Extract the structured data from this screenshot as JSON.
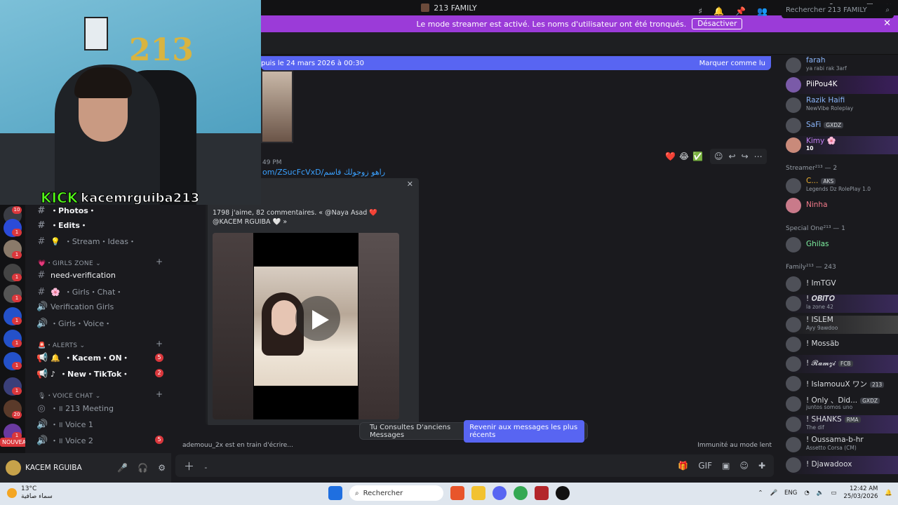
{
  "window": {
    "title": "213 FAMILY",
    "controls": [
      "—",
      "☐",
      "✕"
    ]
  },
  "streamer_banner": {
    "text": "Le mode streamer est activé. Les noms d'utilisateur ont été tronqués.",
    "button": "Désactiver"
  },
  "header": {
    "search_placeholder": "Rechercher 213 FAMILY"
  },
  "new_messages_bar": {
    "text": "puis le 24 mars 2026 à 00:30",
    "action": "Marquer comme lu"
  },
  "message": {
    "time": "49 PM",
    "link": "om/ZSucFcVxD/",
    "link_rtl": "راهو زوجولك قاسم",
    "embed_desc": "1798 j'aime, 82 commentaires. « @Naya Asad ❤️ @KACEM RGUIBA 🤍 »"
  },
  "older_bar": {
    "text": "Tu Consultes D'anciens Messages",
    "button": "Revenir aux messages les plus récents"
  },
  "typing": {
    "text": "ademouu_2x est en train d'écrire...",
    "slowmode": "Immunité au mode lent"
  },
  "composer": {
    "placeholder": "-"
  },
  "channels": {
    "photos": "・Photos・",
    "edits": "・Edits・",
    "stream_ideas": "・Stream・Ideas・",
    "cat_girls": "・GIRLS ZONE",
    "need_verification": "need-verification",
    "girls_chat": "・Girls・Chat・",
    "verification_girls": "Verification Girls",
    "girls_voice": "・Girls・Voice・",
    "cat_alerts": "・ALERTS",
    "kacem_on": "・Kacem・ON・",
    "kacem_on_badge": "5",
    "new_tiktok": "・New・TikTok・",
    "new_tiktok_badge": "2",
    "cat_voice": "・VOICE CHAT",
    "meeting": "・॥ 213 Meeting",
    "voice1": "・॥ Voice 1",
    "voice2": "・॥ Voice 2",
    "voice2_badge": "5"
  },
  "rail_badges": [
    "10",
    "1",
    "1",
    "1",
    "1",
    "1",
    "1",
    "1",
    "1",
    "20",
    "1"
  ],
  "nouveau": "NOUVEAU",
  "user": {
    "name": "KACEM RGUIBA"
  },
  "members": {
    "top": [
      {
        "name": "farah",
        "status": "ya rabi rak 3arf",
        "color": "#8ab4f8"
      },
      {
        "name": "PiiPou4K",
        "status": "",
        "color": "#ffffff"
      },
      {
        "name": "Razik Haifi",
        "status": "NewVibe Roleplay",
        "color": "#8ab4f8"
      },
      {
        "name": "SaFi",
        "status": "",
        "color": "#8ab4f8",
        "tag": "GXDZ"
      },
      {
        "name": "Kimy 🌸",
        "status": "10",
        "color": "#c07ef0"
      }
    ],
    "streamer_group": "Streamer²¹³ — 2",
    "streamer": [
      {
        "name": "C...",
        "status": "Legends Dz RolePlay 1.0",
        "color": "#f0b232",
        "tag": "AKS"
      },
      {
        "name": "Ninha",
        "status": "",
        "color": "#f47b8b"
      }
    ],
    "special_group": "Special One²¹³ — 1",
    "special": [
      {
        "name": "Ghilas",
        "status": "",
        "color": "#7ef0a0"
      }
    ],
    "family_group": "Family²¹³ — 243",
    "family": [
      {
        "name": "! ImTGV",
        "status": "",
        "color": "#ffffff"
      },
      {
        "name": "! 𝑶𝑩𝑰𝑻𝑶",
        "status": "la zone 42",
        "color": "#ffffff"
      },
      {
        "name": "! ISLEM",
        "status": "Ayy 9awdoo",
        "color": "#ffffff"
      },
      {
        "name": "! Mossäb",
        "status": "",
        "color": "#ffffff"
      },
      {
        "name": "! 𝓡𝓪𝓶𝔃𝓲",
        "status": "",
        "color": "#ffffff",
        "tag": "FCB"
      },
      {
        "name": "! IslamouuX ワン",
        "status": "",
        "color": "#ffffff",
        "tag": "213"
      },
      {
        "name": "! Only 、Did...",
        "status": "juntos somos uno",
        "color": "#ffffff",
        "tag": "GXDZ"
      },
      {
        "name": "! SHANKS",
        "status": "The dif",
        "color": "#ffffff",
        "tag": "RMA"
      },
      {
        "name": "! Oussama-b-hr",
        "status": "Assetto Corsa (CM)",
        "color": "#ffffff"
      },
      {
        "name": "! Djawadoox",
        "status": "",
        "color": "#ffffff"
      }
    ]
  },
  "webcam": {
    "platform": "KICK",
    "channel": "kacemrguiba213",
    "balloon": "213"
  },
  "taskbar": {
    "temp": "13°C",
    "weather_desc": "سماء صافية",
    "search": "Rechercher",
    "lang": "ENG",
    "time": "12:42 AM",
    "date": "25/03/2026"
  },
  "colors": {
    "accent": "#5865f2",
    "streamer_banner": "#9b3bd8",
    "danger": "#da373c",
    "kick_green": "#53fc18"
  }
}
